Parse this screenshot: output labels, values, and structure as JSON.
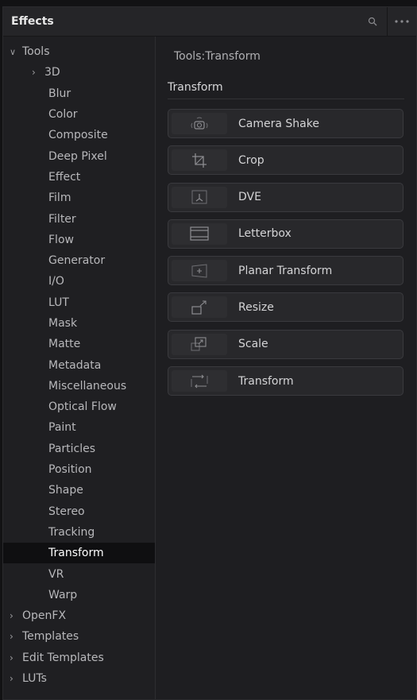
{
  "panel": {
    "title": "Effects"
  },
  "header": {
    "search_icon": "search-icon",
    "options_icon": "more-options-icon"
  },
  "tree": {
    "tools": {
      "label": "Tools"
    },
    "tools_children": [
      {
        "label": "3D",
        "has_children": true
      },
      {
        "label": "Blur"
      },
      {
        "label": "Color"
      },
      {
        "label": "Composite"
      },
      {
        "label": "Deep Pixel"
      },
      {
        "label": "Effect"
      },
      {
        "label": "Film"
      },
      {
        "label": "Filter"
      },
      {
        "label": "Flow"
      },
      {
        "label": "Generator"
      },
      {
        "label": "I/O"
      },
      {
        "label": "LUT"
      },
      {
        "label": "Mask"
      },
      {
        "label": "Matte"
      },
      {
        "label": "Metadata"
      },
      {
        "label": "Miscellaneous"
      },
      {
        "label": "Optical Flow"
      },
      {
        "label": "Paint"
      },
      {
        "label": "Particles"
      },
      {
        "label": "Position"
      },
      {
        "label": "Shape"
      },
      {
        "label": "Stereo"
      },
      {
        "label": "Tracking"
      },
      {
        "label": "Transform",
        "selected": true
      },
      {
        "label": "VR"
      },
      {
        "label": "Warp"
      }
    ],
    "roots": [
      {
        "label": "OpenFX"
      },
      {
        "label": "Templates"
      },
      {
        "label": "Edit Templates"
      },
      {
        "label": "LUTs"
      }
    ]
  },
  "main": {
    "breadcrumb": "Tools:Transform",
    "section_title": "Transform",
    "tools": [
      {
        "label": "Camera Shake",
        "icon": "camera-shake-icon"
      },
      {
        "label": "Crop",
        "icon": "crop-icon"
      },
      {
        "label": "DVE",
        "icon": "dve-icon"
      },
      {
        "label": "Letterbox",
        "icon": "letterbox-icon"
      },
      {
        "label": "Planar Transform",
        "icon": "planar-transform-icon"
      },
      {
        "label": "Resize",
        "icon": "resize-icon"
      },
      {
        "label": "Scale",
        "icon": "scale-icon"
      },
      {
        "label": "Transform",
        "icon": "transform-icon"
      }
    ]
  },
  "colors": {
    "panel_bg": "#1e1e21",
    "selected_bg": "#0f0f11",
    "button_bg": "#28282b",
    "text": "#c9c9c9"
  }
}
